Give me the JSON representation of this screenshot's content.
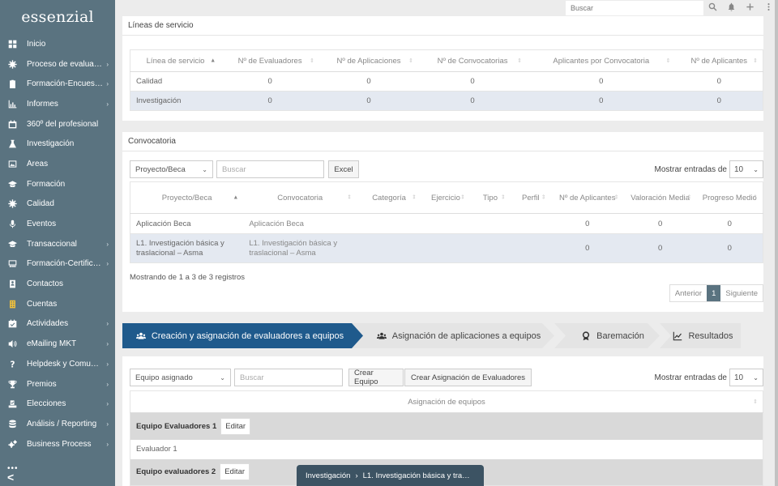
{
  "brand": "essenzial",
  "sidebar": {
    "items": [
      {
        "label": "Inicio",
        "icon": "grid-icon",
        "caret": false
      },
      {
        "label": "Proceso de evalua…",
        "icon": "gear-icon",
        "caret": true
      },
      {
        "label": "Formación-Encues…",
        "icon": "clipboard-icon",
        "caret": true
      },
      {
        "label": "Informes",
        "icon": "chart-icon",
        "caret": true
      },
      {
        "label": "360º del profesional",
        "icon": "calendar-icon",
        "caret": false
      },
      {
        "label": "Investigación",
        "icon": "flask-icon",
        "caret": false
      },
      {
        "label": "Áreas",
        "icon": "image-icon",
        "caret": false
      },
      {
        "label": "Formación",
        "icon": "graduation-cap-icon",
        "caret": false
      },
      {
        "label": "Calidad",
        "icon": "gear-icon",
        "caret": false
      },
      {
        "label": "Eventos",
        "icon": "microphone-icon",
        "caret": false
      },
      {
        "label": "Transaccional",
        "icon": "graduation-cap-icon",
        "caret": true
      },
      {
        "label": "Formación-Certific…",
        "icon": "presentation-icon",
        "caret": true
      },
      {
        "label": "Contactos",
        "icon": "address-book-icon",
        "caret": false
      },
      {
        "label": "Cuentas",
        "icon": "building-icon",
        "caret": false
      },
      {
        "label": "Actividades",
        "icon": "calendar-check-icon",
        "caret": true
      },
      {
        "label": "eMailing MKT",
        "icon": "volume-icon",
        "caret": true
      },
      {
        "label": "Helpdesk y Comun…",
        "icon": "question-icon",
        "caret": true
      },
      {
        "label": "Premios",
        "icon": "trophy-icon",
        "caret": true
      },
      {
        "label": "Elecciones",
        "icon": "vote-icon",
        "caret": true
      },
      {
        "label": "Análisis / Reporting",
        "icon": "database-icon",
        "caret": true
      },
      {
        "label": "Business Process",
        "icon": "cogs-icon",
        "caret": true
      }
    ],
    "more": "•••",
    "collapse": "<"
  },
  "topbar": {
    "search_placeholder": "Buscar"
  },
  "lineas": {
    "title": "Líneas de servicio",
    "headers": [
      "Línea de servicio",
      "Nº de Evaluadores",
      "Nº de Aplicaciones",
      "Nº de Convocatorias",
      "Aplicantes por Convocatoria",
      "Nº de Aplicantes"
    ],
    "rows": [
      [
        "Calidad",
        "0",
        "0",
        "0",
        "0",
        "0"
      ],
      [
        "Investigación",
        "0",
        "0",
        "0",
        "0",
        "0"
      ]
    ]
  },
  "convocatoria": {
    "title": "Convocatoria",
    "filter_select": "Proyecto/Beca",
    "search_placeholder": "Buscar",
    "excel_label": "Excel",
    "show_label": "Mostrar entradas de",
    "page_size": "10",
    "headers": [
      "Proyecto/Beca",
      "Convocatoria",
      "Categoría",
      "Ejercicio",
      "Tipo",
      "Perfil",
      "Nº de Aplicantes",
      "Valoración Media",
      "Progreso Medio"
    ],
    "rows": [
      [
        "Aplicación Beca",
        "Aplicación Beca",
        "",
        "",
        "",
        "",
        "0",
        "0",
        "0"
      ],
      [
        "L1. Investigación básica y traslacional – Asma",
        "L1. Investigación básica y traslacional – Asma",
        "",
        "",
        "",
        "",
        "0",
        "0",
        "0"
      ]
    ],
    "info": "Mostrando de 1 a 3 de 3 registros",
    "pager": {
      "prev": "Anterior",
      "page": "1",
      "next": "Siguiente"
    }
  },
  "steps": [
    {
      "label": "Creación y asignación de evaluadores a equipos",
      "icon": "users-icon",
      "active": true
    },
    {
      "label": "Asignación de aplicaciones a equipos",
      "icon": "users-icon",
      "active": false
    },
    {
      "label": "Baremación",
      "icon": "award-icon",
      "active": false
    },
    {
      "label": "Resultados",
      "icon": "line-chart-icon",
      "active": false
    }
  ],
  "equipos": {
    "filter_select": "Equipo asignado",
    "search_placeholder": "Buscar",
    "crear_equipo": "Crear Equipo",
    "crear_asignacion": "Crear Asignación de Evaluadores",
    "show_label": "Mostrar entradas de",
    "page_size": "10",
    "header": "Asignación de equipos",
    "teams": [
      {
        "name": "Equipo Evaluadores 1",
        "edit": "Editar",
        "members": [
          "Evaluador 1"
        ]
      },
      {
        "name": "Equipo evaluadores 2",
        "edit": "Editar",
        "members": []
      }
    ]
  },
  "breadcrumb": {
    "items": [
      "Investigación",
      "L1. Investigación básica y tra…"
    ],
    "separator": "›"
  }
}
